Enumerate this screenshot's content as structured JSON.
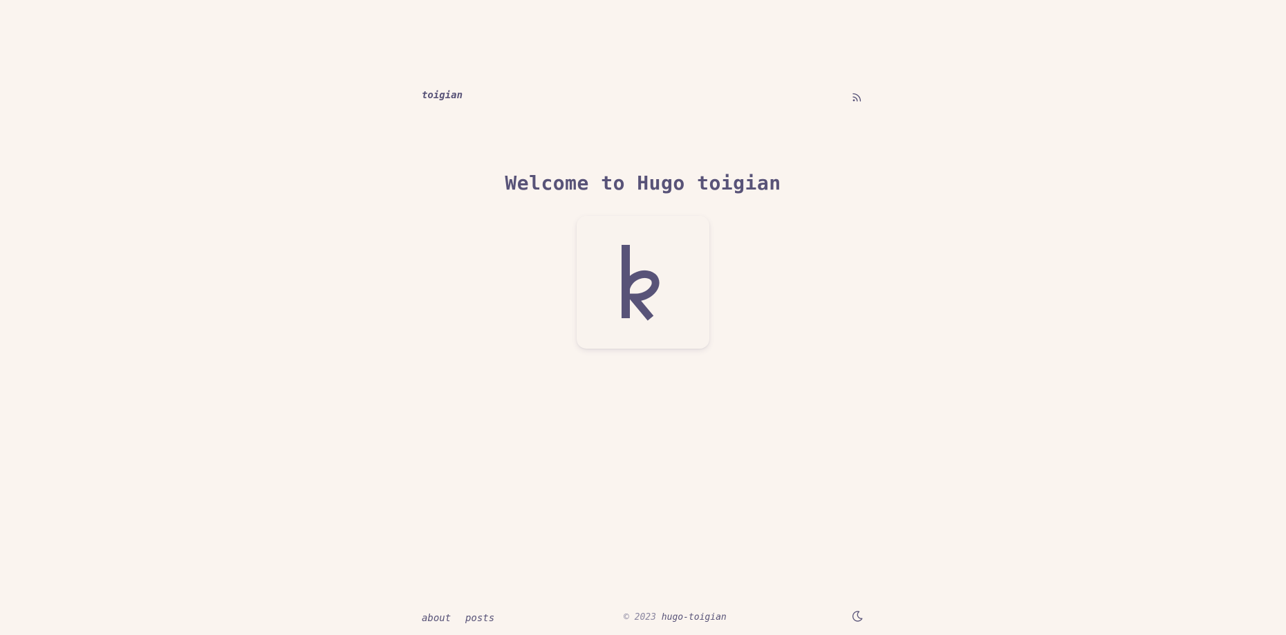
{
  "header": {
    "site_title": "toigian",
    "rss_icon": "rss-icon"
  },
  "main": {
    "title": "Welcome to Hugo toigian",
    "logo_icon": "k-logo-icon"
  },
  "footer": {
    "nav": [
      {
        "label": "about"
      },
      {
        "label": "posts"
      }
    ],
    "copyright_prefix": "© 2023",
    "copyright_owner": "hugo-toigian",
    "theme_toggle_icon": "moon-icon"
  },
  "colors": {
    "background": "#faf4ef",
    "text": "#585378",
    "muted": "#8a86a0",
    "card": "#f9f3ee"
  }
}
